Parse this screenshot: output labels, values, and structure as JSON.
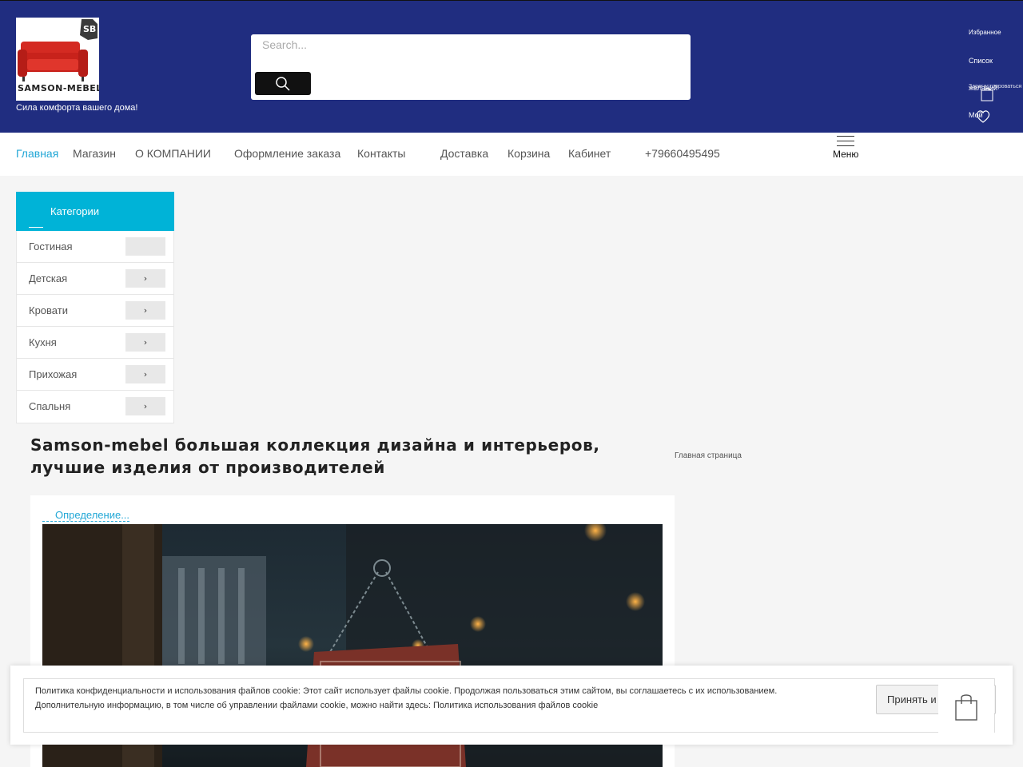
{
  "header": {
    "logo_text": "SAMSON-MEBEL",
    "tagline": "Сила комфорта вашего дома!",
    "search": {
      "placeholder": "Search..."
    },
    "links": {
      "favorites": "Избранное",
      "wishlist_line1": "Список",
      "wishlist_line2": "желаний",
      "register": "Зарегистрироваться",
      "my": "Мой"
    },
    "icons": [
      "search-icon",
      "cart-icon",
      "heart-icon"
    ],
    "bg_color": "#202d80"
  },
  "nav": {
    "items": [
      {
        "label": "Главная",
        "active": true
      },
      {
        "label": "Магазин"
      },
      {
        "label": "О КОМПАНИИ"
      },
      {
        "label": "Оформление заказа"
      },
      {
        "label": "Контакты"
      },
      {
        "label": "Доставка"
      },
      {
        "label": "Корзина"
      },
      {
        "label": "Кабинет"
      },
      {
        "label": "+79660495495"
      }
    ],
    "menu_label": "Меню",
    "accent_color": "#22a7d6"
  },
  "categories": {
    "title": "Категории",
    "items": [
      {
        "label": "Гостиная",
        "has_arrow": false
      },
      {
        "label": "Детская",
        "has_arrow": true
      },
      {
        "label": "Кровати",
        "has_arrow": true
      },
      {
        "label": "Кухня",
        "has_arrow": true
      },
      {
        "label": "Прихожая",
        "has_arrow": true
      },
      {
        "label": "Спальня",
        "has_arrow": true
      }
    ],
    "arrow_glyph": "›",
    "header_color": "#00b3d7"
  },
  "content": {
    "title": "Samson-mebel большая коллекция дизайна и интерьеров, лучшие изделия от производителей",
    "breadcrumb": "Главная страница",
    "definition_link": "Определение..."
  },
  "cookie": {
    "line1": "Политика конфиденциальности и использования файлов cookie: Этот сайт использует файлы cookie. Продолжая пользоваться этим сайтом, вы соглашаетесь с их использованием.",
    "line2": "Дополнительную информацию, в том числе об управлении файлами cookie, можно найти здесь: Политика использования файлов cookie",
    "accept_label": "Принять и закрыть"
  }
}
